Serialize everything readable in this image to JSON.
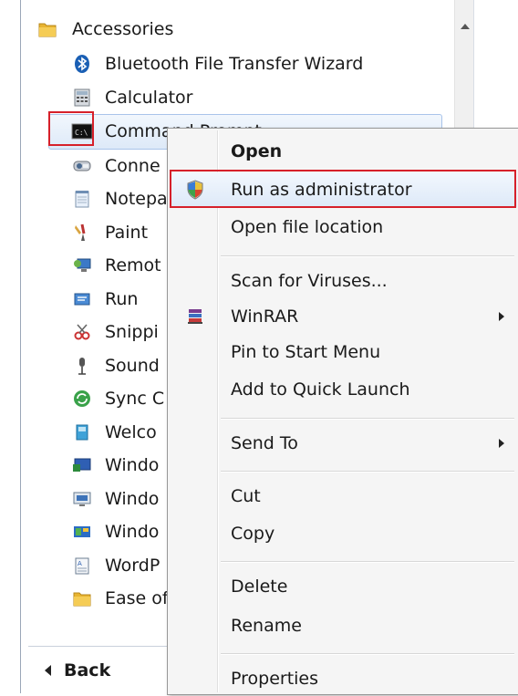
{
  "start_menu": {
    "folder": {
      "label": "Accessories",
      "icon": "folder-icon"
    },
    "items": [
      {
        "label": "Bluetooth File Transfer Wizard",
        "icon": "bluetooth-icon"
      },
      {
        "label": "Calculator",
        "icon": "calculator-icon"
      },
      {
        "label": "Command Prompt",
        "icon": "command-prompt-icon",
        "selected": true
      },
      {
        "label": "Conne",
        "icon": "connect-projector-icon"
      },
      {
        "label": "Notepa",
        "icon": "notepad-icon"
      },
      {
        "label": "Paint",
        "icon": "paint-icon"
      },
      {
        "label": "Remot",
        "icon": "remote-desktop-icon"
      },
      {
        "label": "Run",
        "icon": "run-icon"
      },
      {
        "label": "Snippi",
        "icon": "snipping-tool-icon"
      },
      {
        "label": "Sound",
        "icon": "sound-recorder-icon"
      },
      {
        "label": "Sync C",
        "icon": "sync-center-icon"
      },
      {
        "label": "Welco",
        "icon": "welcome-center-icon"
      },
      {
        "label": "Windo",
        "icon": "windows-explorer-icon"
      },
      {
        "label": "Windo",
        "icon": "windows-mobility-icon"
      },
      {
        "label": "Windo",
        "icon": "windows-sidebar-icon"
      },
      {
        "label": "WordP",
        "icon": "wordpad-icon"
      }
    ],
    "subfolder": {
      "label": "Ease of",
      "icon": "folder-icon"
    },
    "back_label": "Back"
  },
  "context_menu": {
    "open": "Open",
    "run_as_admin": "Run as administrator",
    "open_file_location": "Open file location",
    "scan_for_viruses": "Scan for Viruses...",
    "winrar": "WinRAR",
    "pin_to_start": "Pin to Start Menu",
    "add_to_quick_launch": "Add to Quick Launch",
    "send_to": "Send To",
    "cut": "Cut",
    "copy": "Copy",
    "delete": "Delete",
    "rename": "Rename",
    "properties": "Properties"
  },
  "colors": {
    "highlight_box": "#d6202a",
    "hover_top": "#f2f7fd",
    "hover_bottom": "#dde9f8"
  }
}
